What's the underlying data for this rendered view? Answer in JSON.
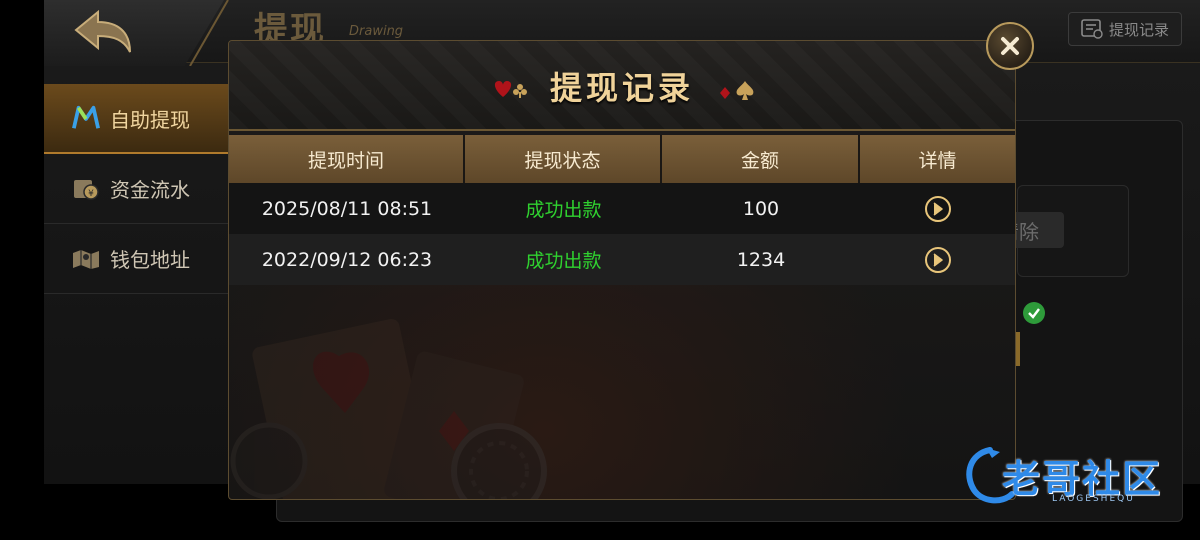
{
  "header": {
    "title": "提现",
    "subtitle": "Drawing",
    "records_button": "提现记录"
  },
  "sidebar": {
    "items": [
      {
        "label": "自助提现",
        "icon": "m-logo-icon",
        "active": true
      },
      {
        "label": "资金流水",
        "icon": "money-flow-icon",
        "active": false
      },
      {
        "label": "钱包地址",
        "icon": "map-icon",
        "active": false
      }
    ]
  },
  "background": {
    "clear_button": "清除"
  },
  "modal": {
    "title": "提现记录",
    "columns": [
      "提现时间",
      "提现状态",
      "金额",
      "详情"
    ],
    "rows": [
      {
        "time": "2025/08/11 08:51",
        "status": "成功出款",
        "amount": "100",
        "detail": "arrow-right-circle-icon"
      },
      {
        "time": "2022/09/12 06:23",
        "status": "成功出款",
        "amount": "1234",
        "detail": "arrow-right-circle-icon"
      }
    ]
  },
  "watermark": {
    "text": "老哥社区",
    "sub": "LAOGESHEQU"
  },
  "colors": {
    "accent_gold": "#f0d39a",
    "status_success": "#2fd12f",
    "table_header": "#6e5433"
  }
}
